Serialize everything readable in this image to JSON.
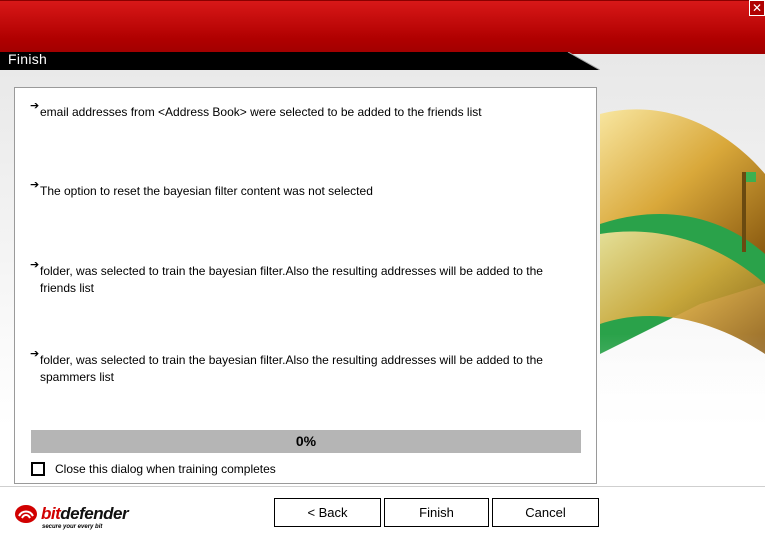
{
  "window": {
    "close_glyph": "✕"
  },
  "header": {
    "title": "Finish"
  },
  "messages": [
    "email addresses from <Address Book> were selected to be added to the friends list",
    "The option to reset the bayesian filter content was not selected",
    "folder, was selected to train the bayesian filter.Also the resulting addresses will be added to the friends list",
    "folder, was selected to train the bayesian filter.Also the resulting addresses will be added to the spammers list"
  ],
  "arrow_glyph": "➔",
  "progress": {
    "label": "0%",
    "fraction": 0
  },
  "checkbox": {
    "label": "Close this dialog when training completes",
    "checked": false
  },
  "buttons": {
    "back": "< Back",
    "finish": "Finish",
    "cancel": "Cancel"
  },
  "logo": {
    "bit": "bit",
    "defender": "defender",
    "tagline": "secure your every bit"
  },
  "colors": {
    "brand_red": "#c40000",
    "title_black": "#000000"
  }
}
